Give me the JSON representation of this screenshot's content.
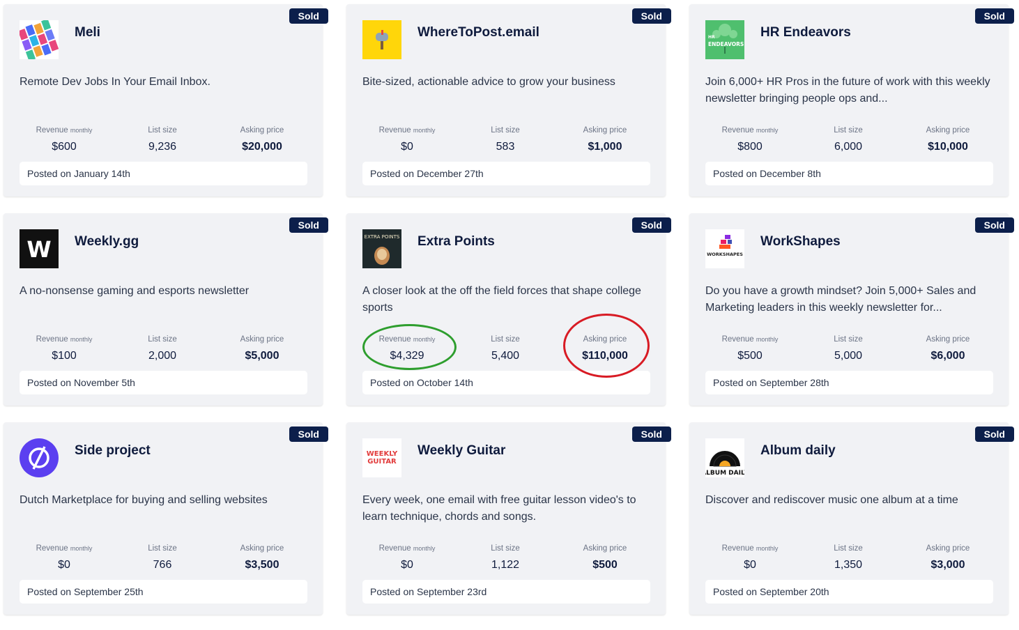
{
  "stat_labels": {
    "revenue": "Revenue",
    "revenue_sub": "monthly",
    "list_size": "List size",
    "asking_price": "Asking price"
  },
  "colors": {
    "badge": "#0c1f4b",
    "highlight_green": "#2e9e2e",
    "highlight_red": "#d81b24"
  },
  "listings": [
    {
      "badge": "Sold",
      "title": "Meli",
      "description": "Remote Dev Jobs In Your Email Inbox.",
      "revenue": "$600",
      "list_size": "9,236",
      "asking_price": "$20,000",
      "posted": "Posted on January 14th",
      "logo_icon": "meli-logo-icon"
    },
    {
      "badge": "Sold",
      "title": "WhereToPost.email",
      "description": "Bite-sized, actionable advice to grow your business",
      "revenue": "$0",
      "list_size": "583",
      "asking_price": "$1,000",
      "posted": "Posted on December 27th",
      "logo_icon": "mailbox-logo-icon"
    },
    {
      "badge": "Sold",
      "title": "HR Endeavors",
      "description": "Join 6,000+ HR Pros in the future of work with this weekly newsletter bringing people ops and...",
      "revenue": "$800",
      "list_size": "6,000",
      "asking_price": "$10,000",
      "posted": "Posted on December 8th",
      "logo_icon": "hr-endeavors-logo-icon",
      "logo_text": "HR ENDEAVORS"
    },
    {
      "badge": "Sold",
      "title": "Weekly.gg",
      "description": "A no-nonsense gaming and esports newsletter",
      "revenue": "$100",
      "list_size": "2,000",
      "asking_price": "$5,000",
      "posted": "Posted on November 5th",
      "logo_icon": "weekly-gg-logo-icon",
      "logo_text": "W"
    },
    {
      "badge": "Sold",
      "title": "Extra Points",
      "description": "A closer look at the off the field forces that shape college sports",
      "revenue": "$4,329",
      "list_size": "5,400",
      "asking_price": "$110,000",
      "posted": "Posted on October 14th",
      "logo_icon": "extra-points-logo-icon",
      "logo_text": "EXTRA POINTS"
    },
    {
      "badge": "Sold",
      "title": "WorkShapes",
      "description": "Do you have a growth mindset? Join 5,000+ Sales and Marketing leaders in this weekly newsletter for...",
      "revenue": "$500",
      "list_size": "5,000",
      "asking_price": "$6,000",
      "posted": "Posted on September 28th",
      "logo_icon": "workshapes-logo-icon",
      "logo_text": "WORKSHAPES"
    },
    {
      "badge": "Sold",
      "title": "Side project",
      "description": "Dutch Marketplace for buying and selling websites",
      "revenue": "$0",
      "list_size": "766",
      "asking_price": "$3,500",
      "posted": "Posted on September 25th",
      "logo_icon": "side-project-logo-icon"
    },
    {
      "badge": "Sold",
      "title": "Weekly Guitar",
      "description": "Every week, one email with free guitar lesson video's to learn technique, chords and songs.",
      "revenue": "$0",
      "list_size": "1,122",
      "asking_price": "$500",
      "posted": "Posted on September 23rd",
      "logo_icon": "weekly-guitar-logo-icon",
      "logo_text": "WEEKLY GUITAR"
    },
    {
      "badge": "Sold",
      "title": "Album daily",
      "description": "Discover and rediscover music one album at a time",
      "revenue": "$0",
      "list_size": "1,350",
      "asking_price": "$3,000",
      "posted": "Posted on September 20th",
      "logo_icon": "album-daily-logo-icon",
      "logo_text": "ALBUM DAILY"
    }
  ]
}
